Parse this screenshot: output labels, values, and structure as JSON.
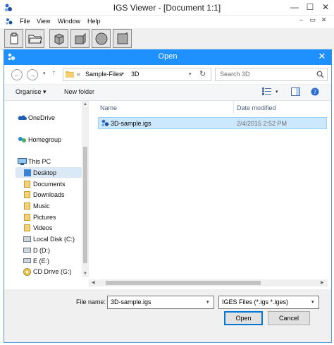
{
  "main_window": {
    "title": "IGS Viewer - [Document 1:1]",
    "controls": {
      "minimize": "—",
      "maximize": "☐",
      "close": "✕"
    },
    "mdi_controls": {
      "minimize": "–",
      "restore": "▭",
      "close": "✕"
    },
    "menu": [
      "File",
      "View",
      "Window",
      "Help"
    ]
  },
  "dialog": {
    "title": "Open",
    "close": "✕",
    "breadcrumb": {
      "prefix": "«",
      "items": [
        "Sample-Files",
        "3D"
      ]
    },
    "search_placeholder": "Search 3D",
    "organise": "Organise ▾",
    "new_folder": "New folder",
    "nav": {
      "onedrive": "OneDrive",
      "homegroup": "Homegroup",
      "thispc": "This PC",
      "items": [
        "Desktop",
        "Documents",
        "Downloads",
        "Music",
        "Pictures",
        "Videos",
        "Local Disk (C:)",
        "D (D:)",
        "E (E:)",
        "CD Drive (G:)"
      ]
    },
    "columns": {
      "name": "Name",
      "date": "Date modified"
    },
    "files": [
      {
        "name": "3D-sample.igs",
        "date": "2/4/2015 2:52 PM"
      }
    ],
    "filename_label": "File name:",
    "filename_value": "3D-sample.igs",
    "filetype_value": "IGES Files (*.igs *.iges)",
    "open_button": "Open",
    "cancel_button": "Cancel"
  }
}
